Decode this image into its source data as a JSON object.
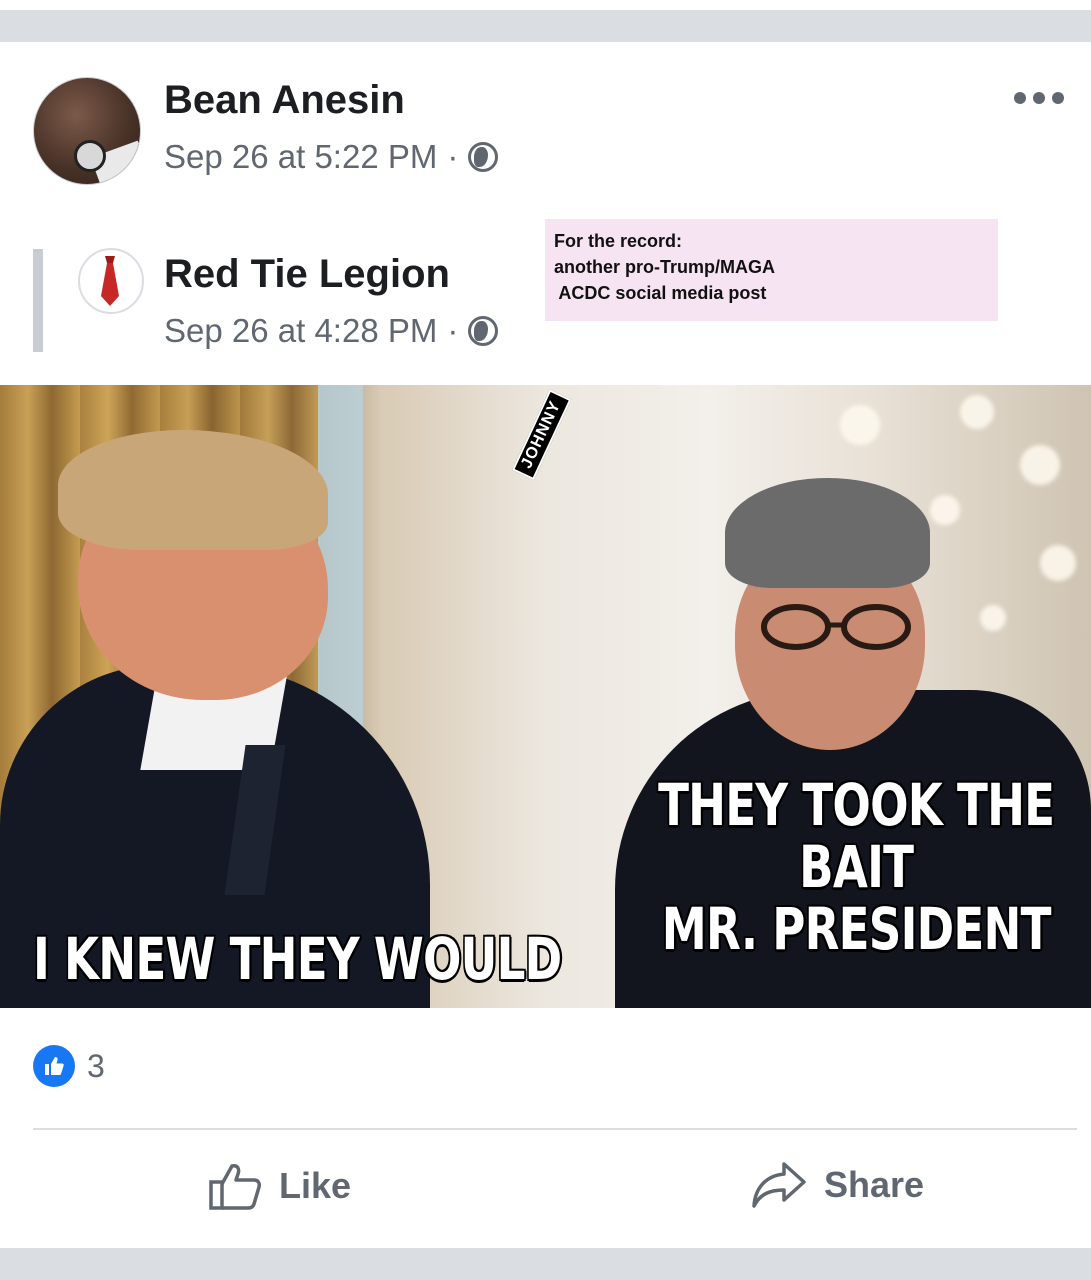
{
  "post": {
    "author": "Bean Anesin",
    "timestamp": "Sep 26 at 5:22 PM",
    "separator": "·",
    "privacy_icon": "globe-icon",
    "more_icon": "more-dots-icon"
  },
  "shared_post": {
    "page_name": "Red Tie Legion",
    "timestamp": "Sep 26 at 4:28 PM",
    "separator": "·",
    "privacy_icon": "globe-icon",
    "avatar_icon": "red-tie-icon"
  },
  "annotation": {
    "line1": "For the record:",
    "line2": "another pro-Trump/MAGA",
    "line3": " ACDC social media post"
  },
  "meme": {
    "caption_left": "I KNEW THEY WOULD",
    "caption_right_line1": "THEY TOOK THE BAIT",
    "caption_right_line2": "MR. PRESIDENT",
    "watermark": "JOHNNY"
  },
  "reactions": {
    "icon": "like-reaction-icon",
    "count": "3"
  },
  "actions": {
    "like_label": "Like",
    "share_label": "Share"
  },
  "colors": {
    "like_blue": "#1877f2",
    "secondary_text": "#606770",
    "annotation_bg": "#f7e4f2"
  }
}
